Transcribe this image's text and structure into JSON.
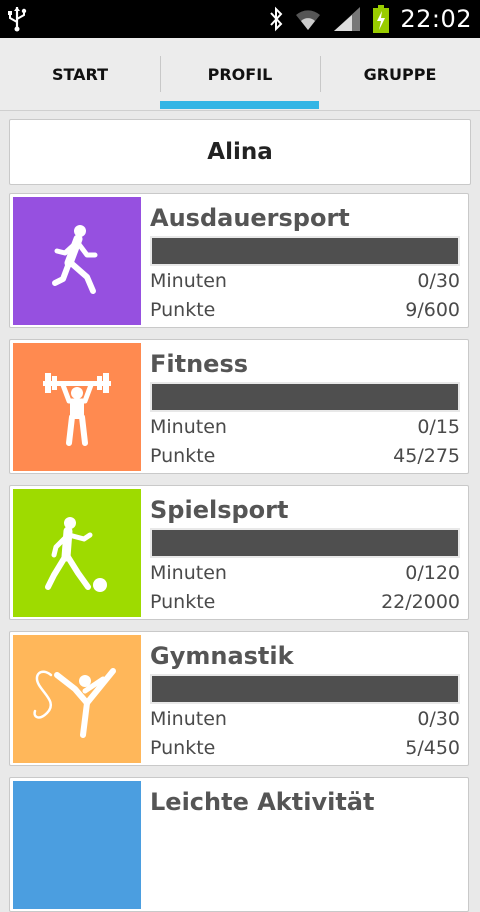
{
  "status_bar": {
    "time": "22:02",
    "icons": [
      "usb-icon",
      "bluetooth-icon",
      "wifi-icon",
      "signal-icon",
      "battery-charging-icon"
    ]
  },
  "tabs": [
    {
      "label": "START",
      "selected": false
    },
    {
      "label": "PROFIL",
      "selected": true
    },
    {
      "label": "GRUPPE",
      "selected": false
    }
  ],
  "accent_color": "#33b5e5",
  "profile": {
    "name": "Alina"
  },
  "cards": [
    {
      "title": "Ausdauersport",
      "color": "#9650e0",
      "icon": "running-icon",
      "minutes_label": "Minuten",
      "minutes": "0/30",
      "points_label": "Punkte",
      "points": "9/600",
      "progress": 1.0
    },
    {
      "title": "Fitness",
      "color": "#ff8a50",
      "icon": "weightlifting-icon",
      "minutes_label": "Minuten",
      "minutes": "0/15",
      "points_label": "Punkte",
      "points": "45/275",
      "progress": 1.0
    },
    {
      "title": "Spielsport",
      "color": "#9edb00",
      "icon": "soccer-icon",
      "minutes_label": "Minuten",
      "minutes": "0/120",
      "points_label": "Punkte",
      "points": "22/2000",
      "progress": 1.0
    },
    {
      "title": "Gymnastik",
      "color": "#ffb75a",
      "icon": "gymnastics-icon",
      "minutes_label": "Minuten",
      "minutes": "0/30",
      "points_label": "Punkte",
      "points": "5/450",
      "progress": 1.0
    },
    {
      "title": "Leichte Aktivität",
      "color": "#4b9ee0",
      "icon": "light-activity-icon"
    }
  ]
}
